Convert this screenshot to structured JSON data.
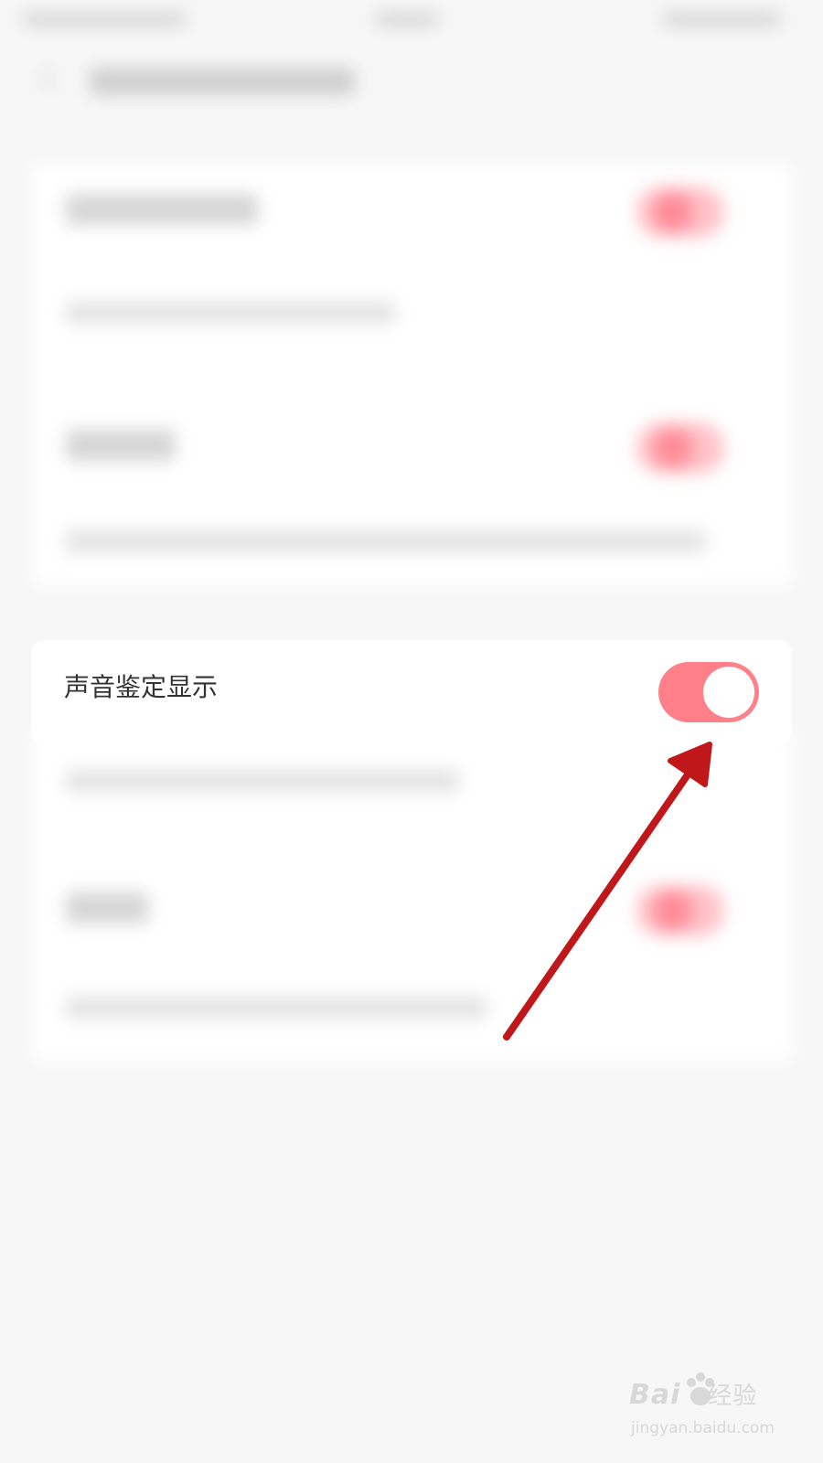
{
  "setting_row": {
    "label": "声音鉴定显示",
    "toggle_on": true
  },
  "colors": {
    "toggle_on": "#ff8088",
    "toggle_knob": "#ffffff",
    "arrow": "#c0181a",
    "background": "#f7f7f7",
    "card": "#ffffff"
  },
  "watermark": {
    "logo": "Bai",
    "logo_suffix": "经验",
    "site": "jingyan.baidu.com"
  }
}
